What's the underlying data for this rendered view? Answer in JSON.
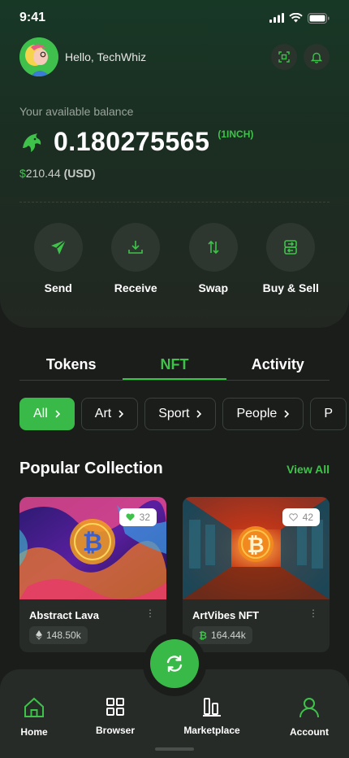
{
  "status_bar": {
    "time": "9:41"
  },
  "header": {
    "greeting": "Hello, TechWhiz"
  },
  "balance": {
    "label": "Your available balance",
    "amount": "0.180275565",
    "unit": "(1INCH)",
    "fiat_symbol": "$",
    "fiat_amount": "210.44",
    "fiat_code": "(USD)"
  },
  "actions": [
    {
      "label": "Send",
      "icon": "send-icon"
    },
    {
      "label": "Receive",
      "icon": "download-icon"
    },
    {
      "label": "Swap",
      "icon": "swap-arrows-icon"
    },
    {
      "label": "Buy & Sell",
      "icon": "exchange-icon"
    }
  ],
  "tabs": [
    {
      "label": "Tokens",
      "active": false
    },
    {
      "label": "NFT",
      "active": true
    },
    {
      "label": "Activity",
      "active": false
    }
  ],
  "chips": [
    {
      "label": "All",
      "active": true
    },
    {
      "label": "Art",
      "active": false
    },
    {
      "label": "Sport",
      "active": false
    },
    {
      "label": "People",
      "active": false
    },
    {
      "label": "P",
      "active": false
    }
  ],
  "section": {
    "title": "Popular Collection",
    "view_all": "View All"
  },
  "cards": [
    {
      "title": "Abstract Lava",
      "likes": "32",
      "liked": true,
      "price": "148.50k",
      "currency_icon": "ethereum-icon"
    },
    {
      "title": "ArtVibes NFT",
      "likes": "42",
      "liked": false,
      "price": "164.44k",
      "currency_icon": "bitcoin-icon"
    }
  ],
  "nav": [
    {
      "label": "Home",
      "active": true,
      "icon": "home-icon"
    },
    {
      "label": "Browser",
      "active": false,
      "icon": "grid-icon"
    },
    {
      "label": "Marketplace",
      "active": false,
      "icon": "bar-chart-icon"
    },
    {
      "label": "Account",
      "active": true,
      "icon": "user-icon"
    }
  ],
  "colors": {
    "accent": "#3ec24a",
    "background": "#1b1d1b",
    "surface": "#262b27"
  }
}
